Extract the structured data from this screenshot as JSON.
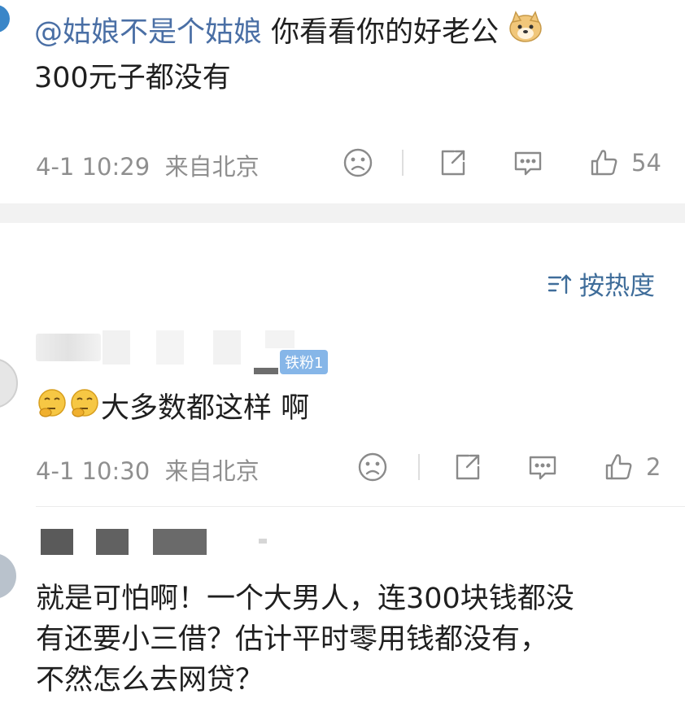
{
  "comment1": {
    "mention": "@姑娘不是个姑娘",
    "line1_rest": " 你看看你的好老公",
    "line1_emoji": "doge-emoji",
    "line2": "300元子都没有",
    "time": "4-1 10:29",
    "location": "来自北京",
    "like_count": "54"
  },
  "sort_label": "按热度",
  "reply1": {
    "badge": "铁粉1",
    "emoji": "thinking-face-emoji",
    "text": "大多数都这样 啊",
    "time": "4-1 10:30",
    "location": "来自北京",
    "like_count": "2"
  },
  "reply2": {
    "line1": "就是可怕啊！一个大男人，连300块钱都没",
    "line2": "有还要小三借？估计平时零用钱都没有，",
    "line3": "不然怎么去网贷？"
  },
  "colors": {
    "mention": "#4a6fa5",
    "sort": "#3f6d9a",
    "badge": "#86b6e8",
    "meta": "#8f8f8f"
  }
}
